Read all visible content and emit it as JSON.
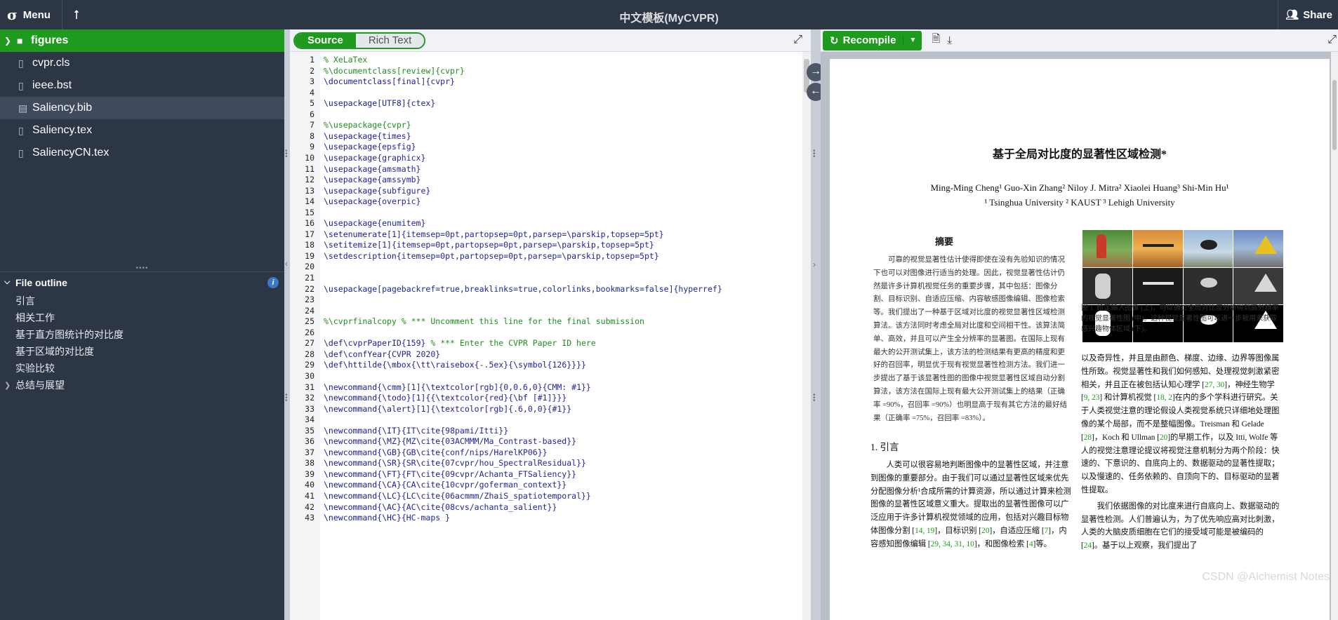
{
  "topbar": {
    "menu_label": "Menu",
    "title": "中文模板(MyCVPR)",
    "share_label": "Share"
  },
  "files": [
    {
      "name": "figures",
      "type": "folder",
      "icon": "folder-icon"
    },
    {
      "name": "cvpr.cls",
      "type": "file",
      "icon": "file-icon"
    },
    {
      "name": "ieee.bst",
      "type": "file",
      "icon": "file-icon"
    },
    {
      "name": "Saliency.bib",
      "type": "file",
      "icon": "book-icon",
      "selected": true
    },
    {
      "name": "Saliency.tex",
      "type": "file",
      "icon": "file-icon"
    },
    {
      "name": "SaliencyCN.tex",
      "type": "file",
      "icon": "file-icon"
    }
  ],
  "outline": {
    "title": "File outline",
    "info_label": "i",
    "items": [
      "引言",
      "相关工作",
      "基于直方图统计的对比度",
      "基于区域的对比度",
      "实验比较",
      "总结与展望"
    ]
  },
  "editor": {
    "tab_source": "Source",
    "tab_rich": "Rich Text",
    "lines": [
      {
        "n": "1",
        "t": "% XeLaTex"
      },
      {
        "n": "2",
        "t": "%\\documentclass[review]{cvpr}"
      },
      {
        "n": "3",
        "t": "\\documentclass[final]{cvpr}"
      },
      {
        "n": "4",
        "t": ""
      },
      {
        "n": "5",
        "t": "\\usepackage[UTF8]{ctex}"
      },
      {
        "n": "6",
        "t": ""
      },
      {
        "n": "7",
        "t": "%\\usepackage{cvpr}"
      },
      {
        "n": "8",
        "t": "\\usepackage{times}"
      },
      {
        "n": "9",
        "t": "\\usepackage{epsfig}"
      },
      {
        "n": "10",
        "t": "\\usepackage{graphicx}"
      },
      {
        "n": "11",
        "t": "\\usepackage{amsmath}"
      },
      {
        "n": "12",
        "t": "\\usepackage{amssymb}"
      },
      {
        "n": "13",
        "t": "\\usepackage{subfigure}"
      },
      {
        "n": "14",
        "t": "\\usepackage{overpic}"
      },
      {
        "n": "15",
        "t": ""
      },
      {
        "n": "16",
        "t": "\\usepackage{enumitem}"
      },
      {
        "n": "17",
        "t": "\\setenumerate[1]{itemsep=0pt,partopsep=0pt,parsep=\\parskip,topsep=5pt}"
      },
      {
        "n": "18",
        "t": "\\setitemize[1]{itemsep=0pt,partopsep=0pt,parsep=\\parskip,topsep=5pt}"
      },
      {
        "n": "19",
        "t": "\\setdescription{itemsep=0pt,partopsep=0pt,parsep=\\parskip,topsep=5pt}"
      },
      {
        "n": "20",
        "t": ""
      },
      {
        "n": "21",
        "t": ""
      },
      {
        "n": "22",
        "t": "\\usepackage[pagebackref=true,breaklinks=true,colorlinks,bookmarks=false]{hyperref}"
      },
      {
        "n": "23",
        "t": ""
      },
      {
        "n": "24",
        "t": ""
      },
      {
        "n": "25",
        "t": "%\\cvprfinalcopy % *** Uncomment this line for the final submission"
      },
      {
        "n": "26",
        "t": ""
      },
      {
        "n": "27",
        "t": "\\def\\cvprPaperID{159} % *** Enter the CVPR Paper ID here"
      },
      {
        "n": "28",
        "t": "\\def\\confYear{CVPR 2020}"
      },
      {
        "n": "29",
        "t": "\\def\\httilde{\\mbox{\\tt\\raisebox{-.5ex}{\\symbol{126}}}}"
      },
      {
        "n": "30",
        "t": ""
      },
      {
        "n": "31",
        "t": "\\newcommand{\\cmm}[1]{\\textcolor[rgb]{0,0.6,0}{CMM: #1}}"
      },
      {
        "n": "32",
        "t": "\\newcommand{\\todo}[1]{{\\textcolor{red}{\\bf [#1]}}}"
      },
      {
        "n": "33",
        "t": "\\newcommand{\\alert}[1]{\\textcolor[rgb]{.6,0,0}{#1}}"
      },
      {
        "n": "34",
        "t": ""
      },
      {
        "n": "35",
        "t": "\\newcommand{\\IT}{IT\\cite{98pami/Itti}}"
      },
      {
        "n": "36",
        "t": "\\newcommand{\\MZ}{MZ\\cite{03ACMMM/Ma_Contrast-based}}"
      },
      {
        "n": "37",
        "t": "\\newcommand{\\GB}{GB\\cite{conf/nips/HarelKP06}}"
      },
      {
        "n": "38",
        "t": "\\newcommand{\\SR}{SR\\cite{07cvpr/hou_SpectralResidual}}"
      },
      {
        "n": "39",
        "t": "\\newcommand{\\FT}{FT\\cite{09cvpr/Achanta_FTSaliency}}"
      },
      {
        "n": "40",
        "t": "\\newcommand{\\CA}{CA\\cite{10cvpr/goferman_context}}"
      },
      {
        "n": "41",
        "t": "\\newcommand{\\LC}{LC\\cite{06acmmm/ZhaiS_spatiotemporal}}"
      },
      {
        "n": "42",
        "t": "\\newcommand{\\AC}{AC\\cite{08cvs/achanta_salient}}"
      },
      {
        "n": "43",
        "t": "\\newcommand{\\HC}{HC-maps }"
      }
    ]
  },
  "preview": {
    "recompile_label": "Recompile",
    "paper": {
      "title": "基于全局对比度的显著性区域检测*",
      "authors": "Ming-Ming Cheng¹    Guo-Xin Zhang²    Niloy J. Mitra²    Xiaolei Huang³    Shi-Min Hu¹",
      "affiliations": "¹ Tsinghua University      ² KAUST      ³ Lehigh University",
      "abstract_heading": "摘要",
      "abstract": "可靠的视觉显著性估计使得即使在没有先验知识的情况下也可以对图像进行适当的处理。因此，视觉显著性估计仍然是许多计算机视觉任务的重要步骤，其中包括：图像分割、目标识别、自适应压缩、内容敏感图像编辑、图像检索等。我们提出了一种基于区域对比度的视觉显著性区域检测算法。该方法同时考虑全局对比度和空间相干性。该算法简单、高效，并且可以产生全分辨率的显著图。在国际上现有最大的公开测试集上，该方法的检测结果有更高的精度和更好的召回率，明显优于现有视觉显著性检测方法。我们进一步提出了基于该显著性图的图像中视觉显著性区域自动分割算法，该方法在国际上现有最大公开测试集上的结果（正确率 =90%，召回率 =90%）也明显高于现有其它方法的最好结果（正确率 =75%，召回率 =83%）。",
      "section1_heading": "1. 引言",
      "section1_text_a": "人类可以很容易地判断图像中的显著性区域，并注意到图像的重要部分。由于我们可以通过显著性区域来优先分配图像分析¹合成所需的计算资源，所以通过计算来检测图像的显著性区域意义重大。提取出的显著性图像可以广泛应用于许多计算机视觉领域的应用，包括对兴趣目标物体图像分割 [",
      "cite_a": "14, 19",
      "section1_text_b": "]，目标识别 [",
      "cite_b": "20",
      "section1_text_c": "]，自适应压缩 [",
      "cite_c": "7",
      "section1_text_d": "]，内容感知图像编辑 [",
      "cite_d": "29, 34, 31, 10",
      "section1_text_e": "]，和图像检索 [",
      "cite_e": "4",
      "section1_text_f": "]等。",
      "figure_caption": "图 1. 给定输入图像 (上)，可以通过全局对比度分析得到高分辨率的视觉显著性图 (中)。这种视觉显著性图可以进一步被用来获取感兴趣物体区域 (下)。",
      "col2_p1_a": "以及奇异性，并且是由颜色、梯度、边缘、边界等图像属性所致。视觉显著性和我们如何感知、处理视觉刺激紧密相关，并且正在被包括认知心理学 [",
      "col2_cite1": "27, 30",
      "col2_p1_b": "]，神经生物学 [",
      "col2_cite2": "9, 23",
      "col2_p1_c": "] 和计算机视觉 [",
      "col2_cite3": "18, 2",
      "col2_p1_d": "]在内的多个学科进行研究。关于人类视觉注意的理论假设人类视觉系统只详细地处理图像的某个局部，而不是整幅图像。Treisman 和 Gelade [",
      "col2_cite4": "28",
      "col2_p1_e": "]，Koch 和 Ullman [",
      "col2_cite5": "20",
      "col2_p1_f": "]的早期工作，以及 Itti, Wolfe 等人的视觉注意理论提议将视觉注意机制分为两个阶段：快速的、下意识的、自底向上的、数据驱动的显著性提取；以及慢速的、任务依赖的、自顶向下的、目标驱动的显著性提取。",
      "col2_p2_a": "我们依据图像的对比度来进行自底向上、数据驱动的显著性检测。人们普遍认为，为了优先响应高对比刺激，人类的大脑皮质细胞在它们的接受域可能是被编码的 [",
      "col2_cite6": "24",
      "col2_p2_b": "]。基于以上观察，我们提出了"
    }
  },
  "watermark": "CSDN @Alchemist Notes"
}
